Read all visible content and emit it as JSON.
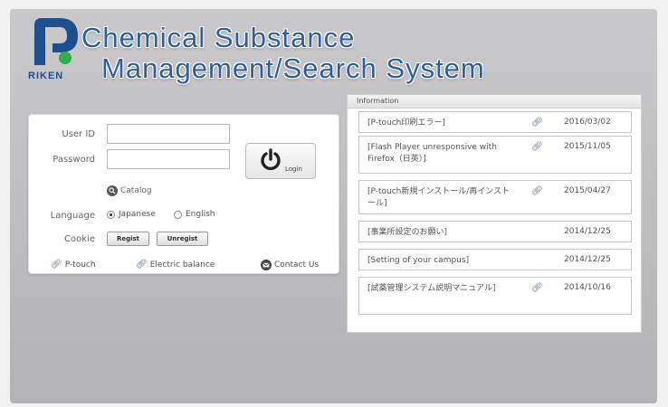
{
  "header": {
    "title_line1": "Chemical Substance",
    "title_line2": "Management/Search System",
    "logo_text": "RIKEN"
  },
  "login": {
    "user_id_label": "User ID",
    "password_label": "Password",
    "user_id_value": "",
    "password_value": "",
    "login_label": "Login",
    "catalog_label": "Catalog",
    "language_label": "Language",
    "language_options": [
      "Japanese",
      "English"
    ],
    "language_selected": "Japanese",
    "cookie_label": "Cookie",
    "regist_label": "Regist",
    "unregist_label": "Unregist",
    "links": {
      "ptouch": "P-touch",
      "electric": "Electric balance",
      "contact": "Contact Us"
    }
  },
  "information": {
    "header": "Information",
    "items": [
      {
        "text": "[P-touch印刷エラー]",
        "attachment": true,
        "date": "2016/03/02"
      },
      {
        "text": "[Flash Player unresponsive with Firefox（日英）]",
        "attachment": true,
        "date": "2015/11/05"
      },
      {
        "text": "[P-touch新規インストール/再インストール]",
        "attachment": true,
        "date": "2015/04/27"
      },
      {
        "text": "[事業所設定のお願い]",
        "attachment": false,
        "date": "2014/12/25"
      },
      {
        "text": "[Setting of your campus]",
        "attachment": false,
        "date": "2014/12/25"
      },
      {
        "text": "[試薬管理システム説明マニュアル]",
        "attachment": true,
        "date": "2014/10/16"
      }
    ]
  },
  "colors": {
    "title_blue": "#2f5f9a",
    "logo_blue": "#1d4f8c",
    "logo_green": "#2fae4a"
  }
}
